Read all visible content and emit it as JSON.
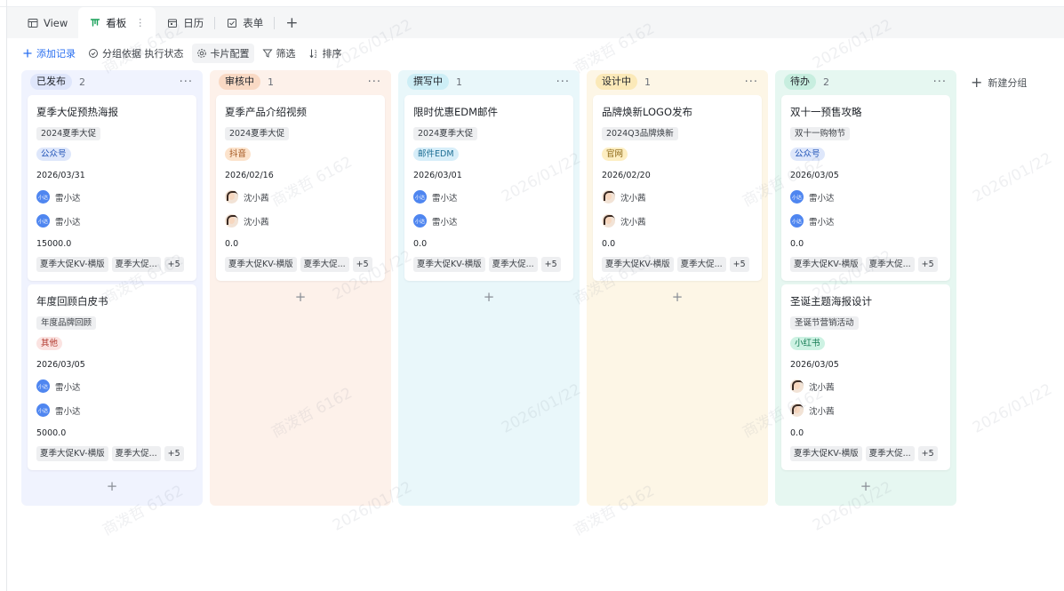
{
  "tabs": [
    {
      "label": "View",
      "icon": "table-icon",
      "active": false
    },
    {
      "label": "看板",
      "icon": "kanban-icon",
      "active": true,
      "more": "⋮"
    },
    {
      "label": "日历",
      "icon": "calendar-icon",
      "active": false
    },
    {
      "label": "表单",
      "icon": "form-icon",
      "active": false
    }
  ],
  "add_tab": "+",
  "toolbar": {
    "add_record": "添加记录",
    "group_by": "分组依据 执行状态",
    "card_config": "卡片配置",
    "filter": "筛选",
    "sort": "排序"
  },
  "columns": [
    {
      "label": "已发布",
      "count": "2",
      "more": "···",
      "add": "+",
      "bg": "#f0f3fe",
      "tag_bg": "#dfe6fb",
      "tag_fg": "#1f2329",
      "cards": [
        {
          "title": "夏季大促预热海报",
          "project": "2024夏季大促",
          "channel": "公众号",
          "channel_bg": "#dee7fb",
          "channel_fg": "#2456b8",
          "date": "2026/03/31",
          "users": [
            "雷小达",
            "雷小达"
          ],
          "avatar": "blue",
          "avatar_text": "小达",
          "amount": "15000.0",
          "tags": [
            "夏季大促KV-横版",
            "夏季大促...",
            "+5"
          ]
        },
        {
          "title": "年度回顾白皮书",
          "project": "年度品牌回顾",
          "channel": "其他",
          "channel_bg": "#fbe3e1",
          "channel_fg": "#b23a30",
          "date": "2026/03/05",
          "users": [
            "雷小达",
            "雷小达"
          ],
          "avatar": "blue",
          "avatar_text": "小达",
          "amount": "5000.0",
          "tags": [
            "夏季大促KV-横版",
            "夏季大促...",
            "+5"
          ]
        }
      ]
    },
    {
      "label": "审核中",
      "count": "1",
      "more": "···",
      "add": "+",
      "bg": "#fdf1ea",
      "tag_bg": "#f9d9c4",
      "tag_fg": "#1f2329",
      "cards": [
        {
          "title": "夏季产品介绍视频",
          "project": "2024夏季大促",
          "channel": "抖音",
          "channel_bg": "#fce3cc",
          "channel_fg": "#a0521a",
          "date": "2026/02/16",
          "users": [
            "沈小茜",
            "沈小茜"
          ],
          "avatar": "photo",
          "avatar_text": "",
          "amount": "0.0",
          "tags": [
            "夏季大促KV-横版",
            "夏季大促...",
            "+5"
          ]
        }
      ]
    },
    {
      "label": "撰写中",
      "count": "1",
      "more": "···",
      "add": "+",
      "bg": "#e9f7fa",
      "tag_bg": "#cdeef6",
      "tag_fg": "#1f2329",
      "cards": [
        {
          "title": "限时优惠EDM邮件",
          "project": "2024夏季大促",
          "channel": "邮件EDM",
          "channel_bg": "#d7eef9",
          "channel_fg": "#1e6e94",
          "date": "2026/03/01",
          "users": [
            "雷小达",
            "雷小达"
          ],
          "avatar": "blue",
          "avatar_text": "小达",
          "amount": "0.0",
          "tags": [
            "夏季大促KV-横版",
            "夏季大促...",
            "+5"
          ]
        }
      ]
    },
    {
      "label": "设计中",
      "count": "1",
      "more": "···",
      "add": "+",
      "bg": "#fdf6e6",
      "tag_bg": "#fbe9b8",
      "tag_fg": "#1f2329",
      "cards": [
        {
          "title": "品牌焕新LOGO发布",
          "project": "2024Q3品牌焕新",
          "channel": "官网",
          "channel_bg": "#fdeec2",
          "channel_fg": "#8a6512",
          "date": "2026/02/20",
          "users": [
            "沈小茜",
            "沈小茜"
          ],
          "avatar": "photo",
          "avatar_text": "",
          "amount": "0.0",
          "tags": [
            "夏季大促KV-横版",
            "夏季大促...",
            "+5"
          ]
        }
      ]
    },
    {
      "label": "待办",
      "count": "2",
      "more": "···",
      "add": "+",
      "bg": "#e6f7f1",
      "tag_bg": "#c7eedf",
      "tag_fg": "#1f2329",
      "cards": [
        {
          "title": "双十一预售攻略",
          "project": "双十一购物节",
          "channel": "公众号",
          "channel_bg": "#dee7fb",
          "channel_fg": "#2456b8",
          "date": "2026/03/05",
          "users": [
            "雷小达",
            "雷小达"
          ],
          "avatar": "blue",
          "avatar_text": "小达",
          "amount": "0.0",
          "tags": [
            "夏季大促KV-横版",
            "夏季大促...",
            "+5"
          ]
        },
        {
          "title": "圣诞主题海报设计",
          "project": "圣诞节营销活动",
          "channel": "小红书",
          "channel_bg": "#cdf2e3",
          "channel_fg": "#137a52",
          "date": "2026/03/05",
          "users": [
            "沈小茜",
            "沈小茜"
          ],
          "avatar": "photo",
          "avatar_text": "",
          "amount": "0.0",
          "tags": [
            "夏季大促KV-横版",
            "夏季大促...",
            "+5"
          ]
        }
      ]
    }
  ],
  "new_group": "新建分组",
  "watermark": [
    "商泼哲 6162",
    "2026/01/22"
  ]
}
